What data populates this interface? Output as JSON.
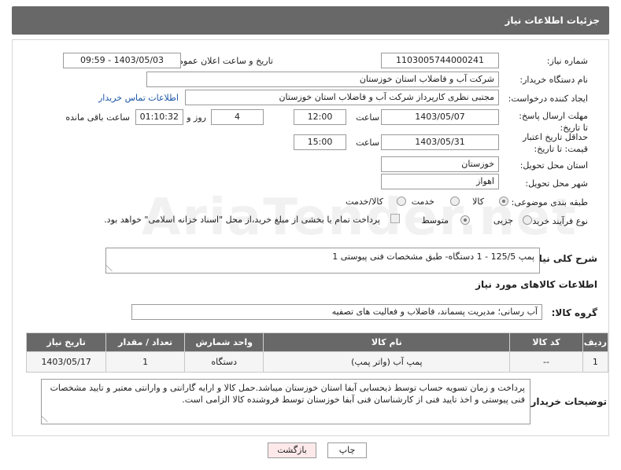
{
  "header": {
    "title": "جزئیات اطلاعات نیاز"
  },
  "need_number": {
    "label": "شماره نیاز:",
    "value": "1103005744000241"
  },
  "announce_date": {
    "label": "تاریخ و ساعت اعلان عمومی:",
    "value": "1403/05/03 - 09:59"
  },
  "buyer_org": {
    "label": "نام دستگاه خریدار:",
    "value": "شرکت آب و فاضلاب استان خوزستان"
  },
  "requester": {
    "label": "ایجاد کننده درخواست:",
    "value": "مجتبی نظری کارپرداز شرکت آب و فاضلاب استان خوزستان",
    "contact_link": "اطلاعات تماس خریدار"
  },
  "deadline": {
    "label": "مهلت ارسال پاسخ: تا تاریخ:",
    "date": "1403/05/07",
    "time_label": "ساعت",
    "time": "12:00",
    "days": "4",
    "days_label": "روز و",
    "remaining": "01:10:32",
    "remaining_label": "ساعت باقی مانده"
  },
  "price_validity": {
    "label": "حداقل تاریخ اعتبار قیمت: تا تاریخ:",
    "date": "1403/05/31",
    "time_label": "ساعت",
    "time": "15:00"
  },
  "province": {
    "label": "استان محل تحویل:",
    "value": "خوزستان"
  },
  "city": {
    "label": "شهر محل تحویل:",
    "value": "اهواز"
  },
  "category": {
    "label": "طبقه بندی موضوعی:",
    "options": [
      "کالا",
      "خدمت",
      "کالا/خدمت"
    ]
  },
  "purchase_type": {
    "label": "نوع فرآیند خرید :",
    "options": [
      "جزیی",
      "متوسط"
    ],
    "note": "پرداخت تمام یا بخشی از مبلغ خرید،از محل \"اسناد خزانه اسلامی\" خواهد بود."
  },
  "summary": {
    "label": "شرح کلی نیاز:",
    "value": "پمپ 125/5 - 1 دستگاه- طبق مشخصات فنی پیوستی 1"
  },
  "goods_info": {
    "title": "اطلاعات کالاهای مورد نیاز"
  },
  "goods_group": {
    "label": "گروه کالا:",
    "value": "آب رسانی؛ مدیریت پسماند، فاضلاب و فعالیت های تصفیه"
  },
  "table": {
    "headers": [
      "ردیف",
      "کد کالا",
      "نام کالا",
      "واحد شمارش",
      "تعداد / مقدار",
      "تاریخ نیاز"
    ],
    "rows": [
      [
        "1",
        "--",
        "پمپ آب (واتر پمپ)",
        "دستگاه",
        "1",
        "1403/05/17"
      ]
    ]
  },
  "buyer_notes": {
    "label": "توضیحات خریدار:",
    "value": "پرداخت و زمان تسویه حساب توسط ذیحسابی آبفا استان خوزستان میباشد.حمل کالا و ارایه گارانتی و وارانتی معتبر و تایید مشخصات فنی پیوستی و اخذ تایید فنی از کارشناسان فنی آبفا خوزستان توسط فروشنده کالا الزامی است."
  },
  "buttons": {
    "print": "چاپ",
    "back": "بازگشت"
  },
  "watermark": "AriaTender.net",
  "colors": {
    "header_bg": "#686868",
    "link": "#1a57a8",
    "back_btn_bg": "#fde9ea"
  }
}
